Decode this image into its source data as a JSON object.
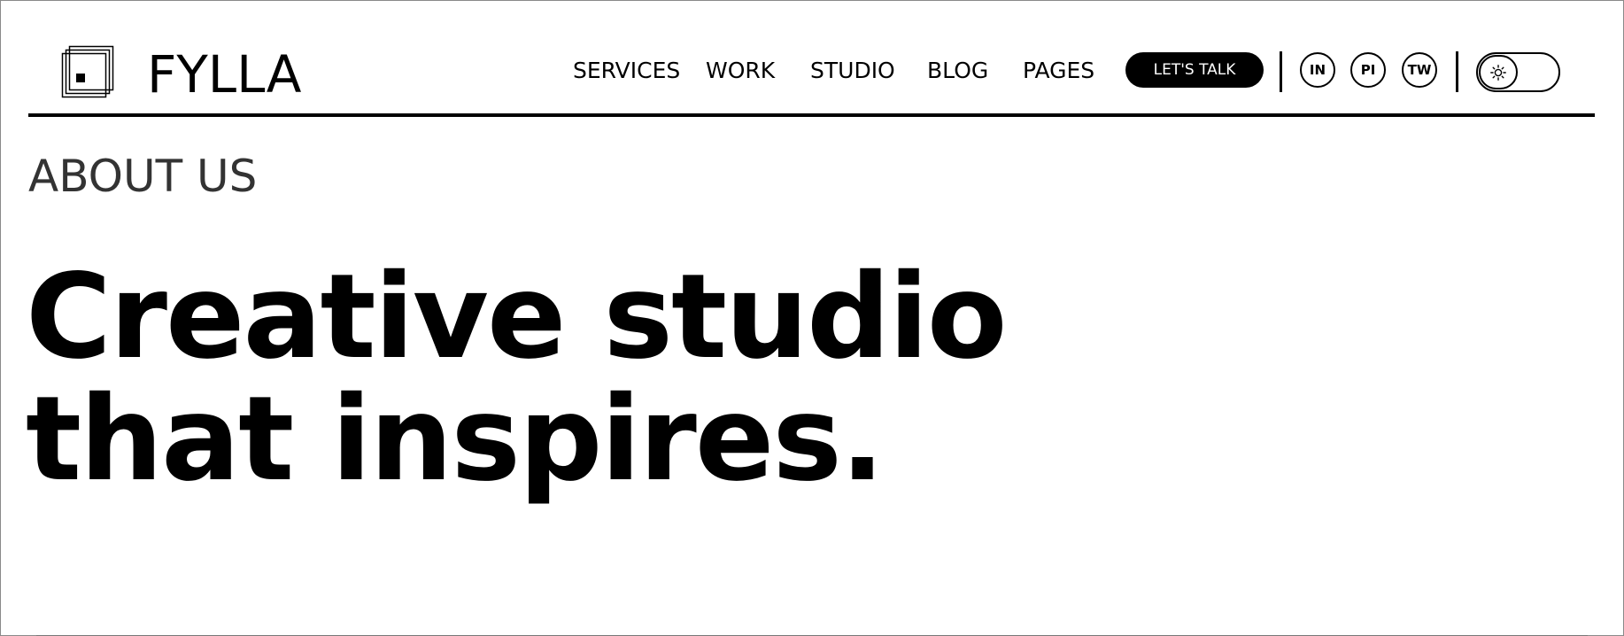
{
  "header": {
    "brand": "FYLLA",
    "nav": [
      "SERVICES",
      "WORK",
      "STUDIO",
      "BLOG",
      "PAGES"
    ],
    "cta_label": "LET'S TALK",
    "social": [
      "IN",
      "PI",
      "TW"
    ],
    "theme_toggle_icon": "sun-icon"
  },
  "hero": {
    "eyebrow": "ABOUT US",
    "headline_line1": "Creative studio",
    "headline_line2": "that inspires."
  },
  "colors": {
    "text": "#000000",
    "background": "#ffffff",
    "eyebrow": "#333333"
  }
}
